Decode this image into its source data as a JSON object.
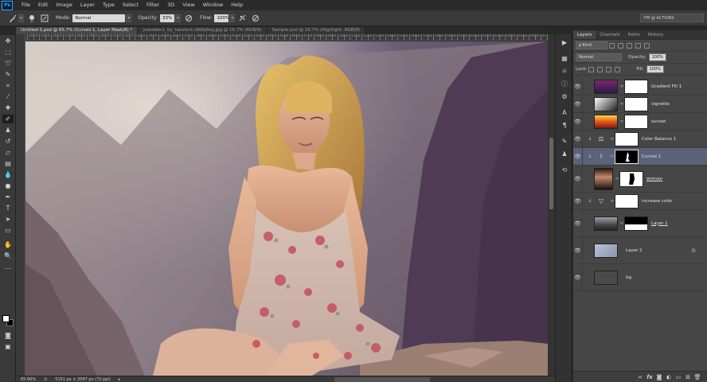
{
  "app": {
    "logo": "Ps"
  },
  "menu": [
    "File",
    "Edit",
    "Image",
    "Layer",
    "Type",
    "Select",
    "Filter",
    "3D",
    "View",
    "Window",
    "Help"
  ],
  "options": {
    "mode_label": "Mode:",
    "mode_value": "Normal",
    "opacity_label": "Opacity:",
    "opacity_value": "33%",
    "flow_label": "Flow:",
    "flow_value": "100%",
    "workspace": "FM @ ACTIONS"
  },
  "tabs": [
    {
      "label": "Untitled-1.psd @ 65.7% (Curves 1, Layer Mask/8) *",
      "active": true
    },
    {
      "label": "yowebbc1_by_taeslock-d68q9oq.jpg @ 16.7% (RGB/8)",
      "active": false
    },
    {
      "label": "Sample.psd @ 16.7% (Highlight, RGB/8)",
      "active": false
    }
  ],
  "ruler_ticks": [
    "2450",
    "2500",
    "2550",
    "2600",
    "2650",
    "2700",
    "2750",
    "2800",
    "2850",
    "2900",
    "2950",
    "3000",
    "3050",
    "3100",
    "3150",
    "3200",
    "3250",
    "3300",
    "3350",
    "3400",
    "3450",
    "3500",
    "3550",
    "3600",
    "3650",
    "3700",
    "3750",
    "3800",
    "3850",
    "3900",
    "3950",
    "4000",
    "4050",
    "4100",
    "4150",
    "4200",
    "4250",
    "4300",
    "4350",
    "4400",
    "4450",
    "4500",
    "4550",
    "4600",
    "4650",
    "4700",
    "4750",
    "4800",
    "4850",
    "4900",
    "4950",
    "5000",
    "5050",
    "5100",
    "5150",
    "5200",
    "5250",
    "5300",
    "5350",
    "5400",
    "5450",
    "5500",
    "5550",
    "5600",
    "5650",
    "5700",
    "5750",
    "5800",
    "5850",
    "5900",
    "5950",
    "6000",
    "6050",
    "6100",
    "6150",
    "6200",
    "6250",
    "6300",
    "6350",
    "6400",
    "6450",
    "6500",
    "6550",
    "6600",
    "6650",
    "6700",
    "6750",
    "6800"
  ],
  "status": {
    "zoom": "65.66%",
    "doc_size": "5151 px × 2097 px (72 ppi)"
  },
  "panel": {
    "tabs": [
      "Layers",
      "Channels",
      "Paths",
      "History"
    ],
    "kind_label": "ρ Kind",
    "blend_mode": "Normal",
    "opacity_label": "Opacity:",
    "opacity_value": "100%",
    "lock_label": "Lock:",
    "fill_label": "Fill:",
    "fill_value": "100%"
  },
  "layers": [
    {
      "name": "Gradient Fill 1",
      "thumb": "gradient-purple",
      "clipped": false,
      "selected": false
    },
    {
      "name": "vignette",
      "thumb": "gradient-gray",
      "clipped": false,
      "selected": false
    },
    {
      "name": "sunset",
      "thumb": "gradient-orange",
      "clipped": false,
      "selected": false
    },
    {
      "name": "Color Balance 1",
      "thumb": "color-balance",
      "clipped": true,
      "selected": false
    },
    {
      "name": "Curves 1",
      "thumb": "curves",
      "clipped": true,
      "selected": true
    },
    {
      "name": "woman",
      "thumb": "photo-woman",
      "clipped": false,
      "selected": false
    },
    {
      "name": "increase color",
      "thumb": "levels",
      "clipped": true,
      "selected": false
    },
    {
      "name": "Layer 1",
      "thumb": "photo-landscape",
      "clipped": false,
      "selected": false
    },
    {
      "name": "Layer 2",
      "thumb": "photo-sky",
      "clipped": false,
      "selected": false
    },
    {
      "name": "bg",
      "thumb": "solid-gray",
      "clipped": false,
      "selected": false
    }
  ]
}
